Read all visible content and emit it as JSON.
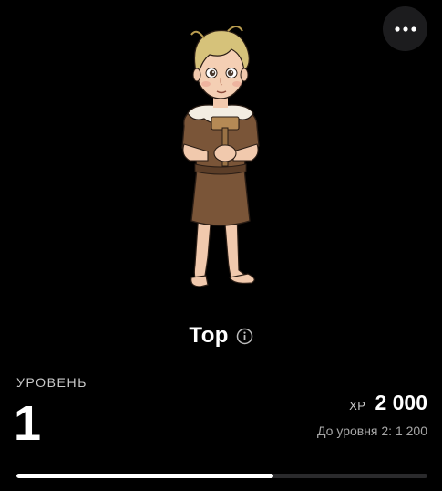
{
  "header": {
    "more_icon": "more-horizontal-icon"
  },
  "character": {
    "name": "Тор",
    "info_icon": "info-icon",
    "image": "child-character-illustration"
  },
  "level": {
    "label": "УРОВЕНЬ",
    "value": "1"
  },
  "xp": {
    "label": "XP",
    "value": "2 000",
    "next_level_text": "До уровня 2: 1 200",
    "progress_fraction": 0.625
  },
  "colors": {
    "background": "#000000",
    "text": "#ffffff",
    "muted_text": "#a6a6a6",
    "track": "#2a2a2c",
    "fill": "#ffffff",
    "button_bg": "#1c1c1e"
  }
}
